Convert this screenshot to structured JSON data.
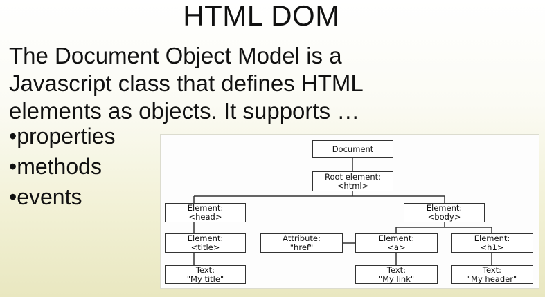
{
  "slide": {
    "title": "HTML DOM",
    "intro_lines": [
      "The Document Object Model is a",
      "Javascript class that defines HTML",
      "elements as objects. It supports …"
    ],
    "bullets": [
      "•properties",
      "•methods",
      "•events"
    ]
  },
  "diagram": {
    "nodes": {
      "document": {
        "line1": "Document",
        "line2": ""
      },
      "root": {
        "line1": "Root element:",
        "line2": "<html>"
      },
      "head": {
        "line1": "Element:",
        "line2": "<head>"
      },
      "body": {
        "line1": "Element:",
        "line2": "<body>"
      },
      "title": {
        "line1": "Element:",
        "line2": "<title>"
      },
      "attribute": {
        "line1": "Attribute:",
        "line2": "\"href\""
      },
      "a": {
        "line1": "Element:",
        "line2": "<a>"
      },
      "h1": {
        "line1": "Element:",
        "line2": "<h1>"
      },
      "text_title": {
        "line1": "Text:",
        "line2": "\"My title\""
      },
      "text_link": {
        "line1": "Text:",
        "line2": "\"My link\""
      },
      "text_header": {
        "line1": "Text:",
        "line2": "\"My header\""
      }
    }
  }
}
